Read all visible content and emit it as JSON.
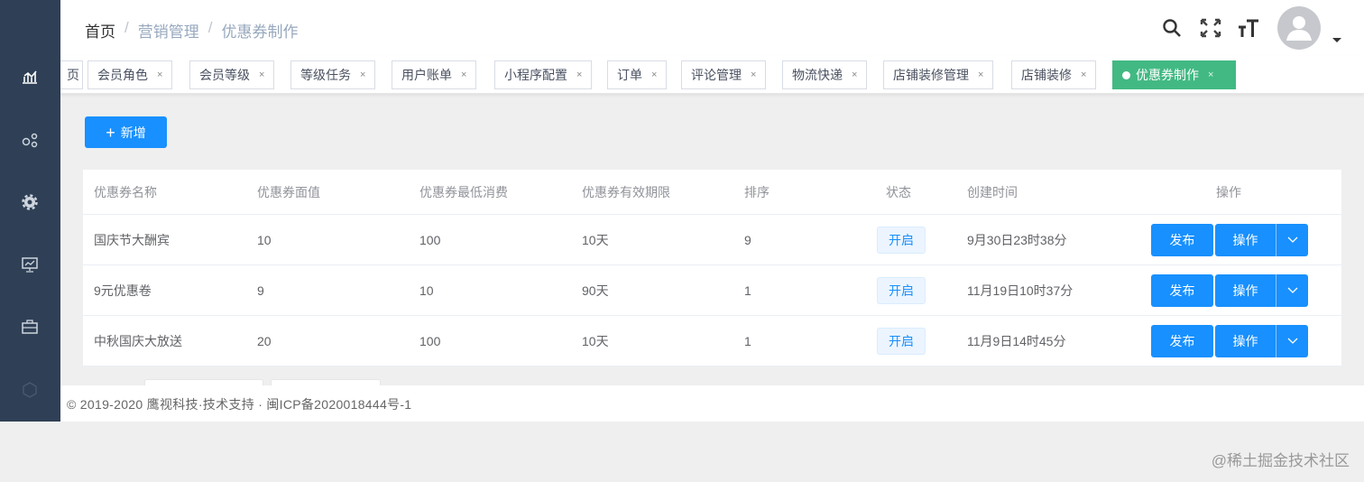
{
  "breadcrumb": [
    "首页",
    "营销管理",
    "优惠券制作"
  ],
  "tags": [
    {
      "label": "页",
      "closable": false
    },
    {
      "label": "会员角色"
    },
    {
      "label": "会员等级"
    },
    {
      "label": "等级任务"
    },
    {
      "label": "用户账单"
    },
    {
      "label": "小程序配置"
    },
    {
      "label": "订单"
    },
    {
      "label": "评论管理"
    },
    {
      "label": "物流快递"
    },
    {
      "label": "店铺装修管理"
    },
    {
      "label": "店铺装修"
    },
    {
      "label": "优惠券制作",
      "active": true
    }
  ],
  "close_glyph": "×",
  "add_label": "新增",
  "table": {
    "headers": [
      "优惠券名称",
      "优惠券面值",
      "优惠券最低消费",
      "优惠券有效期限",
      "排序",
      "状态",
      "创建时间",
      "操作"
    ],
    "rows": [
      {
        "name": "国庆节大酬宾",
        "value": "10",
        "min": "100",
        "days": "10天",
        "sort": "9",
        "status": "开启",
        "created": "9月30日23时38分"
      },
      {
        "name": "9元优惠卷",
        "value": "9",
        "min": "10",
        "days": "90天",
        "sort": "1",
        "status": "开启",
        "created": "11月19日10时37分"
      },
      {
        "name": "中秋国庆大放送",
        "value": "20",
        "min": "100",
        "days": "10天",
        "sort": "1",
        "status": "开启",
        "created": "11月9日14时45分"
      }
    ],
    "publish_label": "发布",
    "action_label": "操作"
  },
  "footer": "© 2019-2020 鹰视科技·技术支持 · 闽ICP备2020018444号-1",
  "watermark": "@稀土掘金技术社区",
  "colors": {
    "primary": "#1890ff",
    "active_tag": "#42b983",
    "sidebar": "#2f4056"
  }
}
